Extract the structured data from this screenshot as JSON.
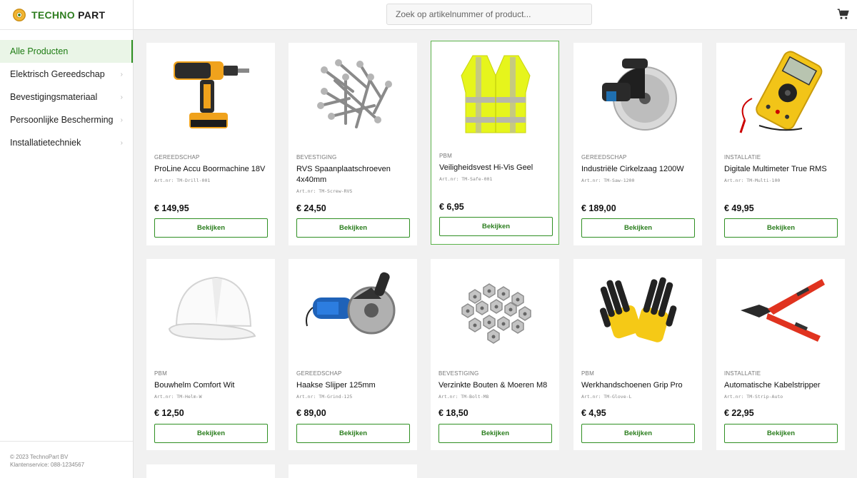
{
  "brand": {
    "name_part1": "TECHNO",
    "name_part2": "PART",
    "accent": "#2e7d1f"
  },
  "search": {
    "placeholder": "Zoek op artikelnummer of product..."
  },
  "cart": {
    "icon": "cart-icon"
  },
  "sidebar": {
    "items": [
      {
        "label": "Alle Producten",
        "active": true
      },
      {
        "label": "Elektrisch Gereedschap"
      },
      {
        "label": "Bevestigingsmateriaal"
      },
      {
        "label": "Persoonlijke Bescherming"
      },
      {
        "label": "Installatietechniek"
      }
    ],
    "footer_line1": "© 2023 TechnoPart BV",
    "footer_line2": "Klantenservice: 088-1234567"
  },
  "products": [
    {
      "category": "GEREEDSCHAP",
      "name": "ProLine Accu Boormachine 18V",
      "sku": "Art.nr: TM-Drill-001",
      "price": "€ 149,95",
      "button": "Bekijken",
      "icon": "drill-icon"
    },
    {
      "category": "BEVESTIGING",
      "name": "RVS Spaanplaatschroeven 4x40mm",
      "sku": "Art.nr: TM-Screw-RVS",
      "price": "€ 24,50",
      "button": "Bekijken",
      "icon": "screws-icon"
    },
    {
      "category": "PBM",
      "name": "Veiligheidsvest Hi-Vis Geel",
      "sku": "Art.nr: TM-Safe-001",
      "price": "€ 6,95",
      "button": "Bekijken",
      "icon": "vest-icon"
    },
    {
      "category": "GEREEDSCHAP",
      "name": "Industriële Cirkelzaag 1200W",
      "sku": "Art.nr: TM-Saw-1200",
      "price": "€ 189,00",
      "button": "Bekijken",
      "icon": "saw-icon"
    },
    {
      "category": "INSTALLATIE",
      "name": "Digitale Multimeter True RMS",
      "sku": "Art.nr: TM-Multi-100",
      "price": "€ 49,95",
      "button": "Bekijken",
      "icon": "multimeter-icon"
    },
    {
      "category": "PBM",
      "name": "Bouwhelm Comfort Wit",
      "sku": "Art.nr: TM-Helm-W",
      "price": "€ 12,50",
      "button": "Bekijken",
      "icon": "helmet-icon"
    },
    {
      "category": "GEREEDSCHAP",
      "name": "Haakse Slijper 125mm",
      "sku": "Art.nr: TM-Grind-125",
      "price": "€ 89,00",
      "button": "Bekijken",
      "icon": "grinder-icon"
    },
    {
      "category": "BEVESTIGING",
      "name": "Verzinkte Bouten & Moeren M8",
      "sku": "Art.nr: TM-Bolt-M8",
      "price": "€ 18,50",
      "button": "Bekijken",
      "icon": "nuts-icon"
    },
    {
      "category": "PBM",
      "name": "Werkhandschoenen Grip Pro",
      "sku": "Art.nr: TM-Glove-L",
      "price": "€ 4,95",
      "button": "Bekijken",
      "icon": "gloves-icon"
    },
    {
      "category": "INSTALLATIE",
      "name": "Automatische Kabelstripper",
      "sku": "Art.nr: TM-Strip-Auto",
      "price": "€ 22,95",
      "button": "Bekijken",
      "icon": "stripper-icon"
    }
  ]
}
